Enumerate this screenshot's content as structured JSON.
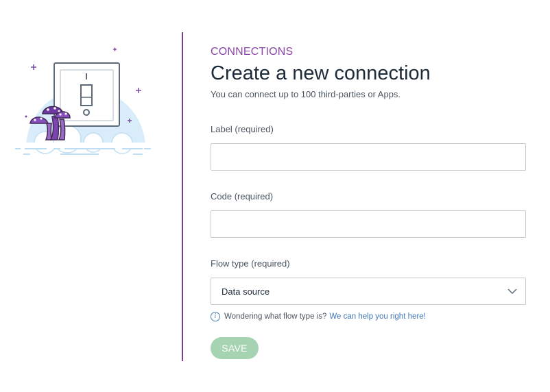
{
  "illustration": {
    "name": "light-switch-mushrooms-illustration"
  },
  "header": {
    "eyebrow": "CONNECTIONS",
    "title": "Create a new connection",
    "subtitle": "You can connect up to 100 third-parties or Apps."
  },
  "form": {
    "label_field": {
      "label": "Label (required)",
      "value": "",
      "placeholder": ""
    },
    "code_field": {
      "label": "Code (required)",
      "value": "",
      "placeholder": ""
    },
    "flow_type": {
      "label": "Flow type (required)",
      "selected": "Data source",
      "icon": "chevron-down-icon"
    },
    "help": {
      "icon": "info-icon",
      "icon_glyph": "i",
      "text": "Wondering what flow type is?",
      "link": "We can help you right here!"
    },
    "save_label": "SAVE"
  },
  "colors": {
    "accent_purple": "#8a46a6",
    "divider": "#7a3f8f",
    "link_blue": "#3f76b4",
    "save_disabled_green": "#a6d3b2",
    "cloud_blue": "#d8ecfa",
    "input_border": "#c6c9cc"
  }
}
